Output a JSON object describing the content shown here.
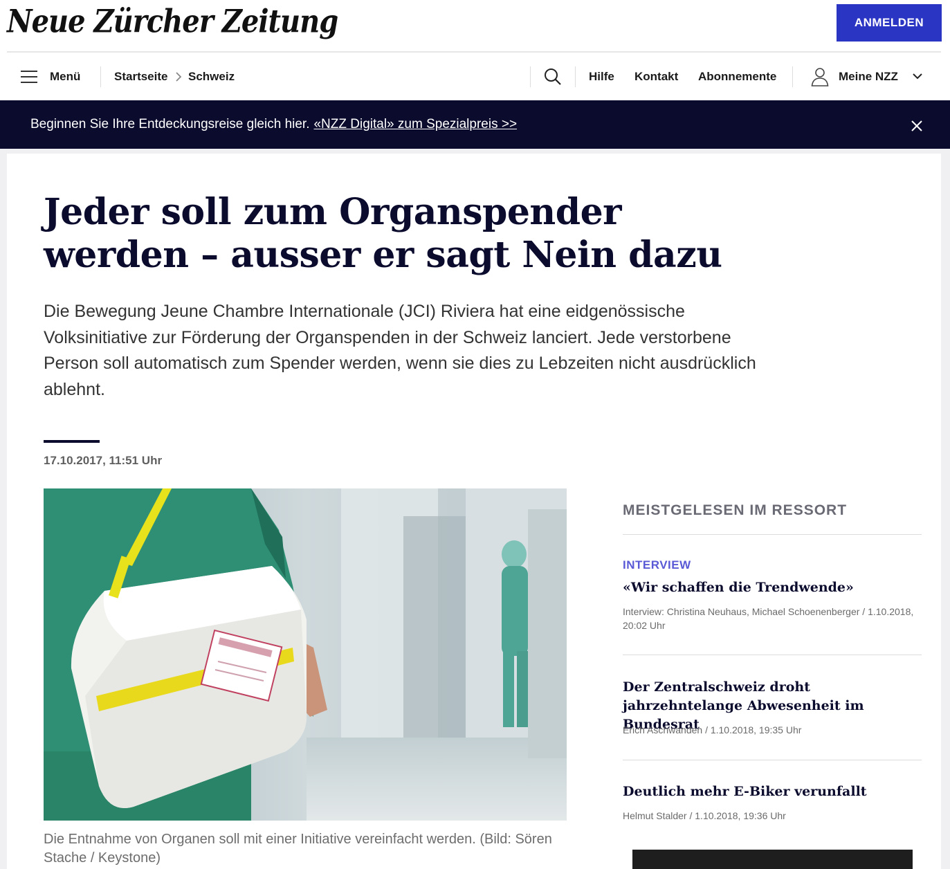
{
  "header": {
    "logo_text": "Neue Zürcher Zeitung",
    "login_label": "ANMELDEN"
  },
  "nav": {
    "menu_label": "Menü",
    "breadcrumb": [
      "Startseite",
      "Schweiz"
    ],
    "links": [
      "Hilfe",
      "Kontakt",
      "Abonnemente"
    ],
    "account_label": "Meine NZZ"
  },
  "promo": {
    "text": "Beginnen Sie Ihre Entdeckungsreise gleich hier.",
    "link": "«NZZ Digital» zum Spezialpreis >>"
  },
  "article": {
    "headline": "Jeder soll zum Organspender werden – ausser er sagt Nein dazu",
    "lead": "Die Bewegung Jeune Chambre Internationale (JCI) Riviera hat eine eidgenössische Volksinitiative zur Förderung der Organspenden in der Schweiz lanciert. Jede verstorbene Person soll automatisch zum Spender werden, wenn sie dies zu Lebzeiten nicht ausdrücklich ablehnt.",
    "date": "17.10.2017, 11:51 Uhr",
    "caption": "Die Entnahme von Organen soll mit einer Initiative vereinfacht werden. (Bild: Sören Stache / Keystone)"
  },
  "sidebar": {
    "title": "MEISTGELESEN IM RESSORT",
    "items": [
      {
        "kicker": "INTERVIEW",
        "headline": "«Wir schaffen die Trendwende»",
        "meta": "Interview: Christina Neuhaus, Michael Schoenenberger / 1.10.2018, 20:02 Uhr"
      },
      {
        "headline": "Der Zentralschweiz droht jahrzehntelange Abwesenheit im Bundesrat",
        "meta": "Erich Aschwanden / 1.10.2018, 19:35 Uhr"
      },
      {
        "headline": "Deutlich mehr E-Biker verunfallt",
        "meta": "Helmut Stalder / 1.10.2018, 19:36 Uhr"
      }
    ]
  },
  "colors": {
    "accent": "#2b35c4",
    "navy": "#0b0b2e",
    "kicker": "#5a5ad6"
  },
  "icons": [
    "menu-icon",
    "chevron-right-icon",
    "search-icon",
    "user-icon",
    "chevron-down-icon",
    "close-icon"
  ]
}
